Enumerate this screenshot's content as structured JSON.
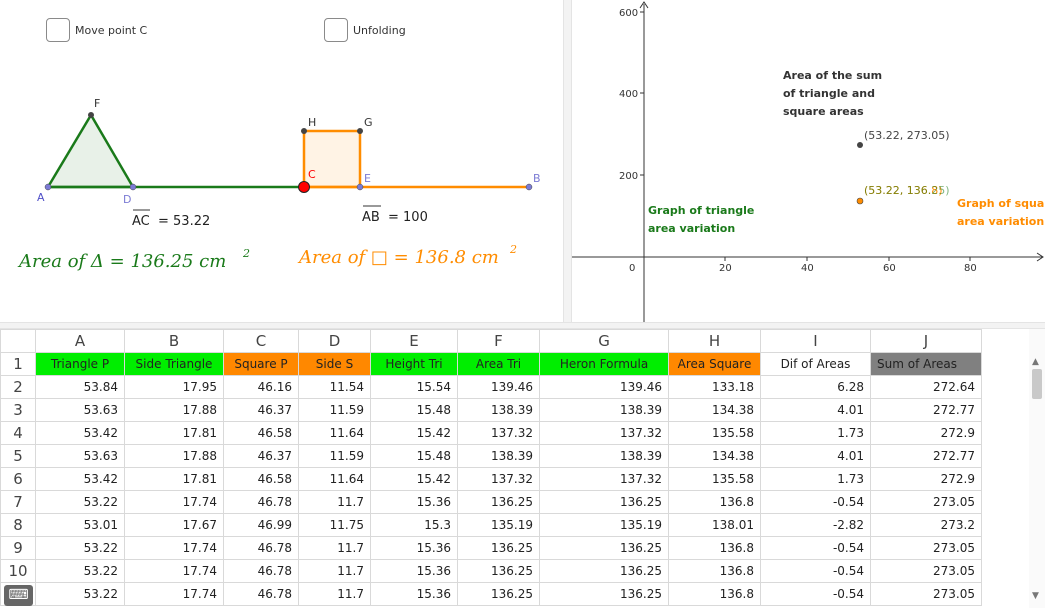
{
  "checkboxes": {
    "move_point_c": "Move point C",
    "unfolding": "Unfolding"
  },
  "geometry": {
    "points": {
      "A": "A",
      "B": "B",
      "C": "C",
      "D": "D",
      "E": "E",
      "F": "F",
      "G": "G",
      "H": "H"
    },
    "ac_label": "AC",
    "ac_value": "= 53.22",
    "ab_label": "AB",
    "ab_value": "= 100",
    "triangle_area_text": "Area of Δ = 136.25 cm",
    "square_area_text": "Area of □ = 136.8 cm",
    "exponent": "2",
    "colors": {
      "triangle": "#1a7a1a",
      "square": "#ff8c00",
      "point_c": "#ff0000",
      "points": "#7b7bd4"
    }
  },
  "graph": {
    "y_ticks": [
      "600",
      "400",
      "200"
    ],
    "x_ticks": [
      "0",
      "20",
      "40",
      "60",
      "80"
    ],
    "sum_title_lines": [
      "Area of the sum",
      "of triangle and",
      "square areas"
    ],
    "sum_point_label": "(53.22, 273.05)",
    "square_point_label": "(53.22, 136.8)",
    "triangle_point_label": "(53.22, 136.25)",
    "triangle_graph_lines": [
      "Graph of triangle",
      "area variation"
    ],
    "square_graph_lines": [
      "Graph of squar",
      "area variation"
    ]
  },
  "spreadsheet": {
    "columns": [
      "A",
      "B",
      "C",
      "D",
      "E",
      "F",
      "G",
      "H",
      "I",
      "J"
    ],
    "headers": [
      {
        "text": "Triangle P",
        "bg": "#00ee00"
      },
      {
        "text": "Side Triangle",
        "bg": "#00ee00"
      },
      {
        "text": "Square P",
        "bg": "#ff8800"
      },
      {
        "text": "Side S",
        "bg": "#ff8800"
      },
      {
        "text": "Height Tri",
        "bg": "#00ee00"
      },
      {
        "text": "Area Tri",
        "bg": "#00ee00"
      },
      {
        "text": "Heron Formula",
        "bg": "#00ee00"
      },
      {
        "text": "Area Square",
        "bg": "#ff8800"
      },
      {
        "text": "Dif of Areas",
        "bg": "#ffffff"
      },
      {
        "text": "Sum of Areas",
        "bg": "#808080"
      }
    ],
    "row_numbers": [
      "1",
      "2",
      "3",
      "4",
      "5",
      "6",
      "7",
      "8",
      "9",
      "10",
      "11"
    ],
    "rows": [
      [
        "53.84",
        "17.95",
        "46.16",
        "11.54",
        "15.54",
        "139.46",
        "139.46",
        "133.18",
        "6.28",
        "272.64"
      ],
      [
        "53.63",
        "17.88",
        "46.37",
        "11.59",
        "15.48",
        "138.39",
        "138.39",
        "134.38",
        "4.01",
        "272.77"
      ],
      [
        "53.42",
        "17.81",
        "46.58",
        "11.64",
        "15.42",
        "137.32",
        "137.32",
        "135.58",
        "1.73",
        "272.9"
      ],
      [
        "53.63",
        "17.88",
        "46.37",
        "11.59",
        "15.48",
        "138.39",
        "138.39",
        "134.38",
        "4.01",
        "272.77"
      ],
      [
        "53.42",
        "17.81",
        "46.58",
        "11.64",
        "15.42",
        "137.32",
        "137.32",
        "135.58",
        "1.73",
        "272.9"
      ],
      [
        "53.22",
        "17.74",
        "46.78",
        "11.7",
        "15.36",
        "136.25",
        "136.25",
        "136.8",
        "-0.54",
        "273.05"
      ],
      [
        "53.01",
        "17.67",
        "46.99",
        "11.75",
        "15.3",
        "135.19",
        "135.19",
        "138.01",
        "-2.82",
        "273.2"
      ],
      [
        "53.22",
        "17.74",
        "46.78",
        "11.7",
        "15.36",
        "136.25",
        "136.25",
        "136.8",
        "-0.54",
        "273.05"
      ],
      [
        "53.22",
        "17.74",
        "46.78",
        "11.7",
        "15.36",
        "136.25",
        "136.25",
        "136.8",
        "-0.54",
        "273.05"
      ],
      [
        "53.22",
        "17.74",
        "46.78",
        "11.7",
        "15.36",
        "136.25",
        "136.25",
        "136.8",
        "-0.54",
        "273.05"
      ]
    ]
  },
  "icons": {
    "keyboard": "keyboard-icon",
    "scroll_up": "scroll-up-icon",
    "scroll_down": "scroll-down-icon"
  }
}
